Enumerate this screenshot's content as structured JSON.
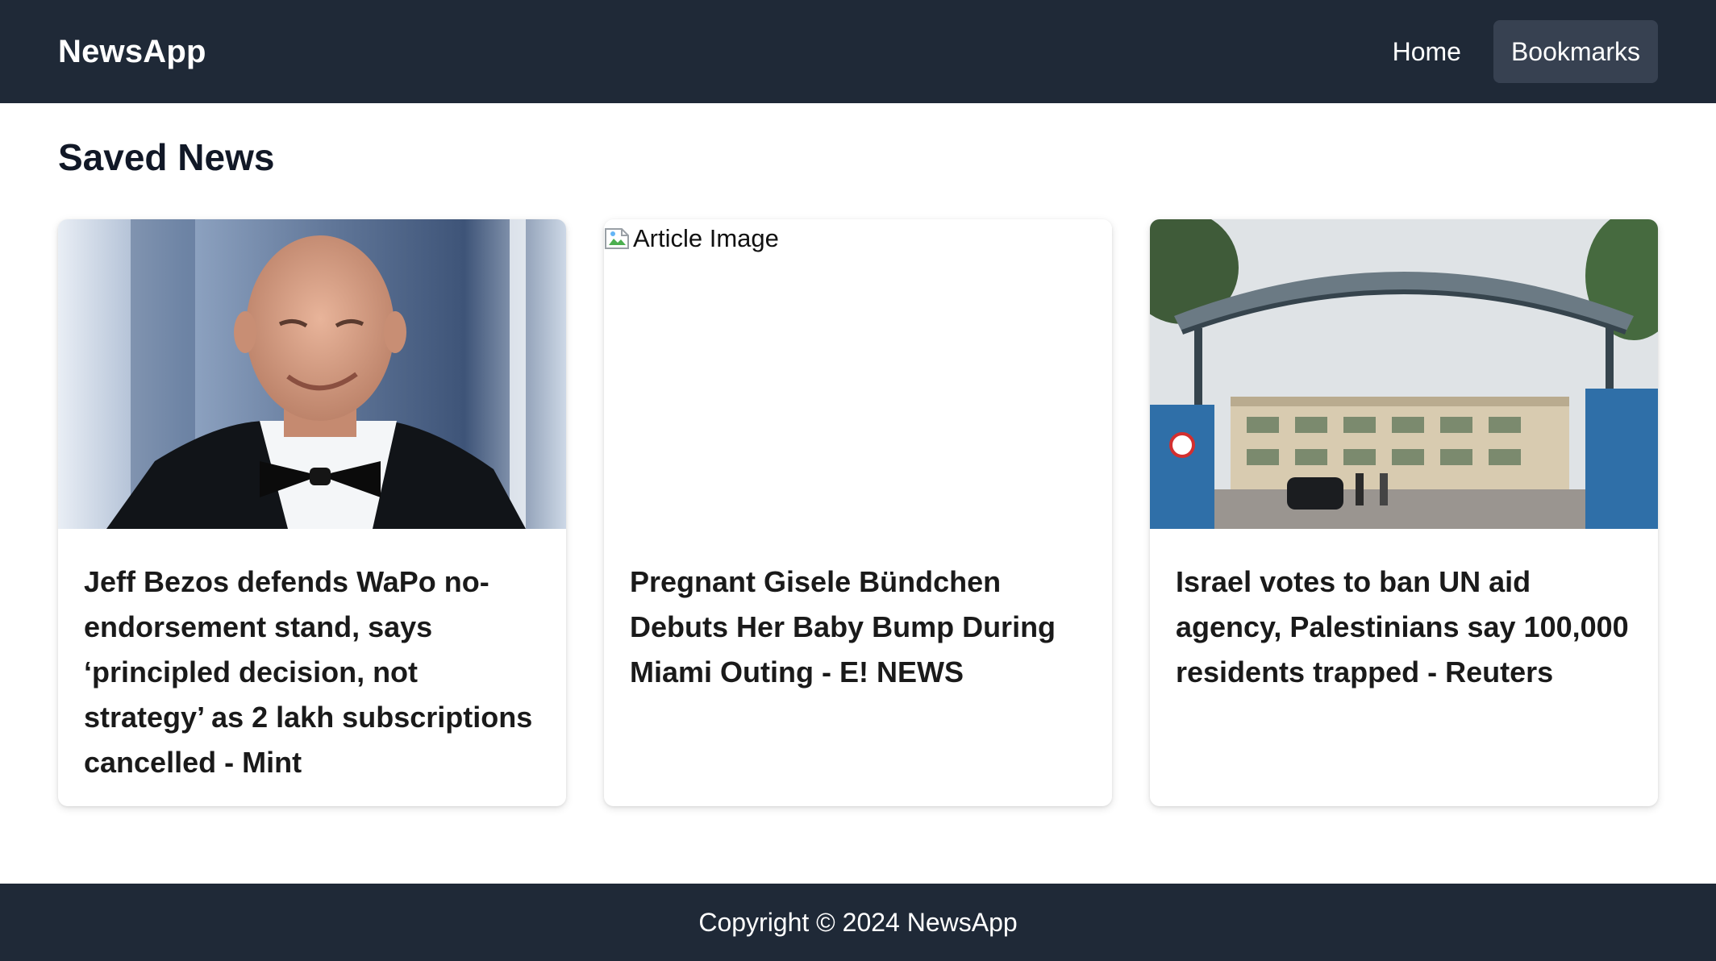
{
  "navbar": {
    "brand": "NewsApp",
    "links": [
      {
        "label": "Home"
      },
      {
        "label": "Bookmarks"
      }
    ]
  },
  "main": {
    "title": "Saved News",
    "articles": [
      {
        "title": "Jeff Bezos defends WaPo no-endorsement stand, says ‘principled decision, not strategy’ as 2 lakh subscriptions cancelled - Mint",
        "image": "photo-portrait"
      },
      {
        "title": "Pregnant Gisele Bündchen Debuts Her Baby Bump During Miami Outing - E! NEWS",
        "image_alt": "Article Image",
        "image": "broken-image-icon"
      },
      {
        "title": "Israel votes to ban UN aid agency, Palestinians say 100,000 residents trapped - Reuters",
        "image": "photo-gate"
      }
    ]
  },
  "footer": {
    "text": "Copyright © 2024 NewsApp"
  },
  "colors": {
    "navbar_bg": "#1f2937",
    "active_link_bg": "#374151",
    "footer_bg": "#1f2937"
  }
}
